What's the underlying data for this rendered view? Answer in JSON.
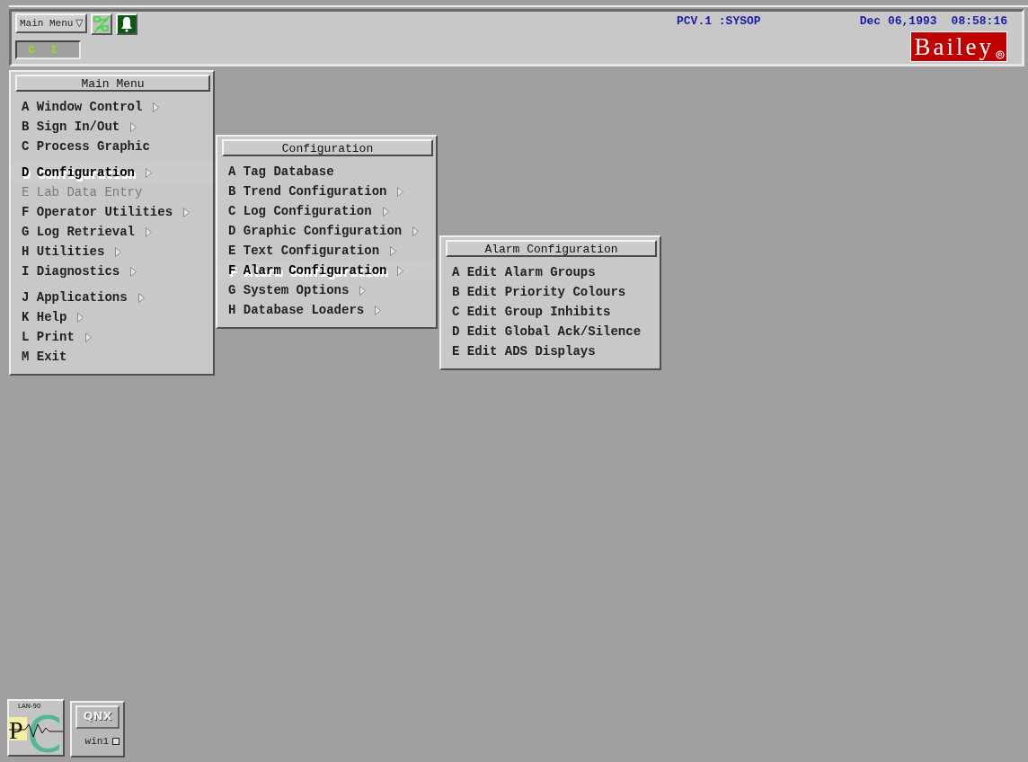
{
  "top_bar": {
    "menu_button": {
      "label": "Main Menu"
    },
    "mode_field": {
      "value": "c  t"
    },
    "user": "PCV.1 :SYSOP",
    "date": "Dec 06,1993",
    "time": "08:58:16",
    "logo": "Bailey"
  },
  "menus": [
    {
      "title": "Main Menu",
      "groups": [
        [
          {
            "label": "A Window Control",
            "submenu": true,
            "selected": false,
            "disabled": false
          },
          {
            "label": "B Sign In/Out",
            "submenu": true,
            "selected": false,
            "disabled": false
          },
          {
            "label": "C Process Graphic",
            "submenu": false,
            "selected": false,
            "disabled": false
          }
        ],
        [
          {
            "label": "D Configuration",
            "submenu": true,
            "selected": true,
            "disabled": false
          },
          {
            "label": "E Lab Data Entry",
            "submenu": false,
            "selected": false,
            "disabled": true
          },
          {
            "label": "F Operator Utilities",
            "submenu": true,
            "selected": false,
            "disabled": false
          },
          {
            "label": "G Log Retrieval",
            "submenu": true,
            "selected": false,
            "disabled": false
          },
          {
            "label": "H Utilities",
            "submenu": true,
            "selected": false,
            "disabled": false
          },
          {
            "label": "I Diagnostics",
            "submenu": true,
            "selected": false,
            "disabled": false
          }
        ],
        [
          {
            "label": "J Applications",
            "submenu": true,
            "selected": false,
            "disabled": false
          },
          {
            "label": "K Help",
            "submenu": true,
            "selected": false,
            "disabled": false
          },
          {
            "label": "L Print",
            "submenu": true,
            "selected": false,
            "disabled": false
          },
          {
            "label": "M Exit",
            "submenu": false,
            "selected": false,
            "disabled": false
          }
        ]
      ]
    },
    {
      "title": "Configuration",
      "groups": [
        [
          {
            "label": "A Tag Database",
            "submenu": false,
            "selected": false,
            "disabled": false
          },
          {
            "label": "B Trend Configuration",
            "submenu": true,
            "selected": false,
            "disabled": false
          },
          {
            "label": "C Log Configuration",
            "submenu": true,
            "selected": false,
            "disabled": false
          },
          {
            "label": "D Graphic Configuration",
            "submenu": true,
            "selected": false,
            "disabled": false
          },
          {
            "label": "E Text Configuration",
            "submenu": true,
            "selected": false,
            "disabled": false
          },
          {
            "label": "F Alarm Configuration",
            "submenu": true,
            "selected": true,
            "disabled": false
          },
          {
            "label": "G System Options",
            "submenu": true,
            "selected": false,
            "disabled": false
          },
          {
            "label": "H Database Loaders",
            "submenu": true,
            "selected": false,
            "disabled": false
          }
        ]
      ]
    },
    {
      "title": "Alarm Configuration",
      "groups": [
        [
          {
            "label": "A Edit Alarm Groups",
            "submenu": false,
            "selected": false,
            "disabled": false
          },
          {
            "label": "B Edit Priority Colours",
            "submenu": false,
            "selected": false,
            "disabled": false
          },
          {
            "label": "C Edit Group Inhibits",
            "submenu": false,
            "selected": false,
            "disabled": false
          },
          {
            "label": "D Edit Global Ack/Silence",
            "submenu": false,
            "selected": false,
            "disabled": false
          },
          {
            "label": "E Edit ADS Displays",
            "submenu": false,
            "selected": false,
            "disabled": false
          }
        ]
      ]
    }
  ],
  "taskbar": {
    "pc_logo": {
      "caption": "LAN-90",
      "letters": [
        "P",
        "C"
      ]
    },
    "qnx_button": {
      "label": "QNX",
      "window": "win1"
    }
  }
}
